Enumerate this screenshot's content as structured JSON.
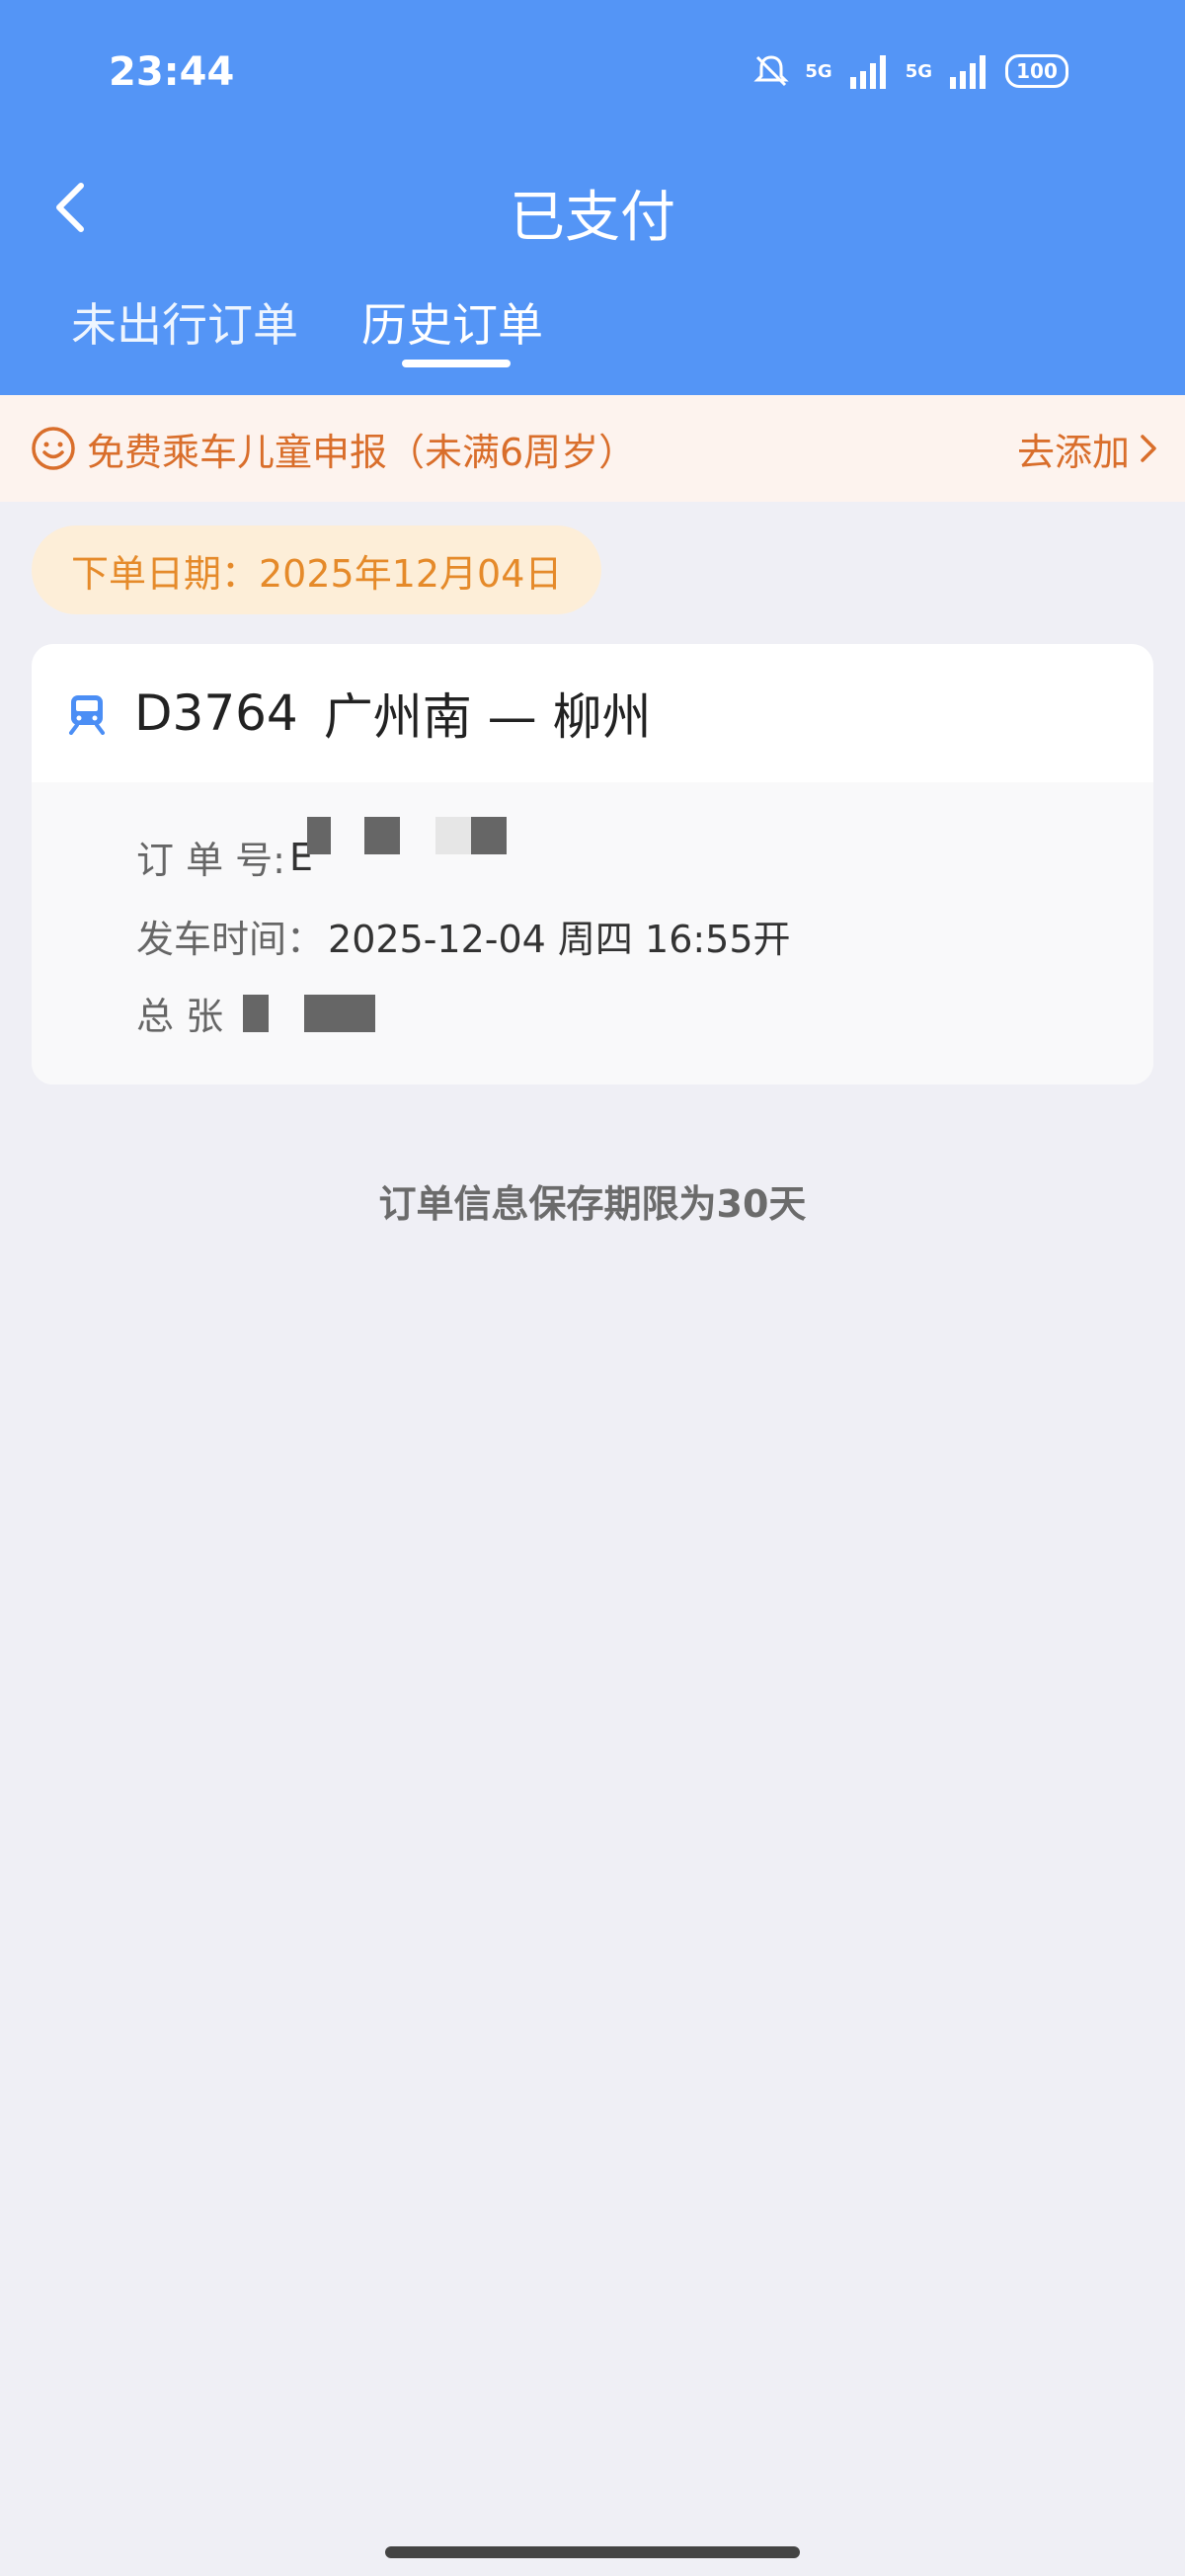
{
  "status_bar": {
    "time": "23:44",
    "sim1": "5G",
    "sim2": "5G",
    "battery": "100",
    "icons": [
      "bell-mute-icon",
      "signal-icon",
      "signal-icon",
      "battery-icon"
    ]
  },
  "header": {
    "title": "已支付",
    "back_icon": "chevron-left-icon",
    "tabs": [
      {
        "label": "未出行订单",
        "active": false
      },
      {
        "label": "历史订单",
        "active": true
      }
    ]
  },
  "notice": {
    "icon": "smile-icon",
    "text": "免费乘车儿童申报（未满6周岁）",
    "action": "去添加",
    "action_icon": "chevron-right-icon"
  },
  "order_date": "下单日期：2025年12月04日",
  "order": {
    "icon": "train-icon",
    "train_no": "D3764",
    "route": "广州南 — 柳州",
    "order_no_label": "订 单 号:",
    "order_no_value": "E",
    "depart_label": "发车时间：",
    "depart_value": "2025-12-04 周四 16:55开",
    "total_label": "总 张"
  },
  "footer_note": "订单信息保存期限为30天",
  "colors": {
    "header_bg": "#5495f6",
    "notice_bg": "#fdf3ee",
    "notice_text": "#d96e2b",
    "date_pill_bg": "#fdeed8",
    "date_pill_text": "#e58a2a",
    "page_bg": "#efeff5"
  }
}
